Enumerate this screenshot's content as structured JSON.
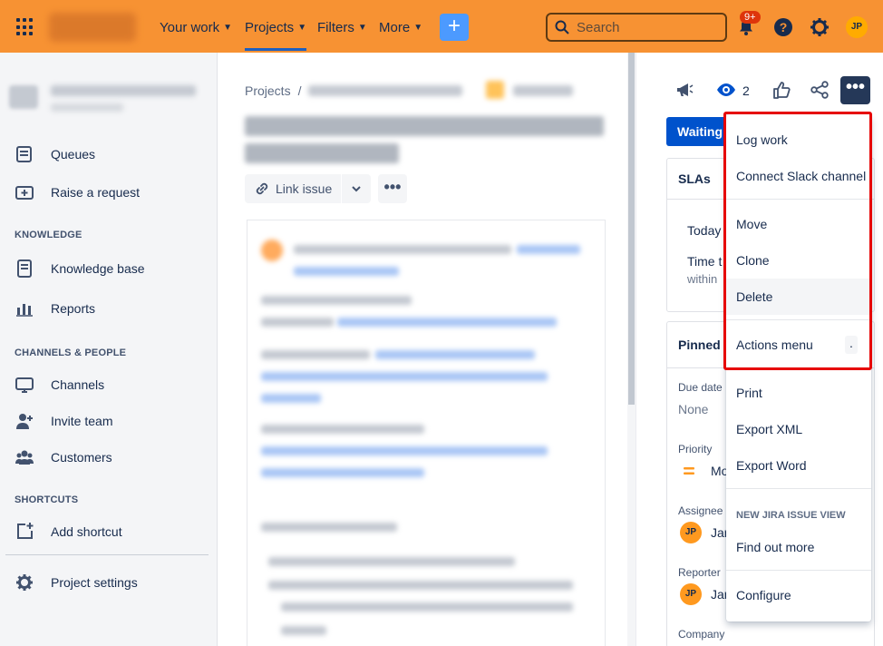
{
  "topnav": {
    "your_work": "Your work",
    "projects": "Projects",
    "filters": "Filters",
    "more": "More",
    "create": "+",
    "search_placeholder": "Search",
    "notifications_badge": "9+",
    "avatar_initials": "JP"
  },
  "sidebar": {
    "items_top": [
      {
        "label": "Queues",
        "icon": "queues-icon"
      },
      {
        "label": "Raise a request",
        "icon": "raise-request-icon"
      }
    ],
    "knowledge_header": "KNOWLEDGE",
    "knowledge_items": [
      {
        "label": "Knowledge base",
        "icon": "knowledge-base-icon"
      },
      {
        "label": "Reports",
        "icon": "reports-icon"
      }
    ],
    "channels_header": "CHANNELS & PEOPLE",
    "channels_items": [
      {
        "label": "Channels",
        "icon": "channels-icon"
      },
      {
        "label": "Invite team",
        "icon": "invite-team-icon"
      },
      {
        "label": "Customers",
        "icon": "customers-icon"
      }
    ],
    "shortcuts_header": "SHORTCUTS",
    "add_shortcut": "Add shortcut",
    "project_settings": "Project settings"
  },
  "main": {
    "breadcrumb_root": "Projects",
    "breadcrumb_sep": "/",
    "link_issue": "Link issue"
  },
  "right_panel": {
    "watch_count": "2",
    "status": "Waiting",
    "slas_title": "SLAs",
    "sla_today": "Today",
    "sla_time": "Time t",
    "sla_within": "within",
    "pinned_title": "Pinned f",
    "due_date_label": "Due date",
    "due_date_value": "None",
    "priority_label": "Priority",
    "priority_value": "Mo",
    "assignee_label": "Assignee",
    "assignee_initials": "JP",
    "assignee_value": "Jan",
    "reporter_label": "Reporter",
    "reporter_initials": "JP",
    "reporter_value": "Jan",
    "company_label": "Company"
  },
  "dropdown": {
    "log_work": "Log work",
    "connect_slack": "Connect Slack channel",
    "move": "Move",
    "clone": "Clone",
    "delete": "Delete",
    "actions_menu": "Actions menu",
    "actions_shortcut": ".",
    "print": "Print",
    "export_xml": "Export XML",
    "export_word": "Export Word",
    "new_view_header": "NEW JIRA ISSUE VIEW",
    "find_out_more": "Find out more",
    "configure": "Configure"
  },
  "colors": {
    "topbar": "#f79233",
    "primary_blue": "#0052cc",
    "highlight_red": "#e60000"
  }
}
